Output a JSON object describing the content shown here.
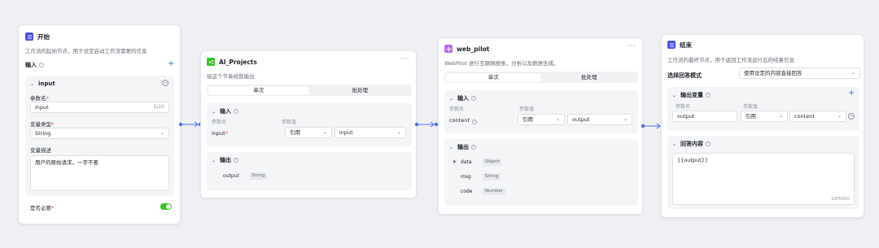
{
  "nodes": {
    "start": {
      "title": "开始",
      "desc": "工作流的起始节点，用于设定启动工作流需要的信息",
      "input_label": "输入",
      "var_name": "input",
      "param_name_label": "参数名",
      "param_name_value": "input",
      "param_name_count": "5/20",
      "var_type_label": "变量类型",
      "var_type_value": "String",
      "var_desc_label": "变量描述",
      "var_desc_value": "用户的原始请求，一字不差",
      "required_label": "是否必要",
      "required_on": true,
      "icon_color": "#4d53e8"
    },
    "ai_projects": {
      "title": "AI_Projects",
      "desc": "接这个节奏给我输出",
      "tab_single": "单次",
      "tab_batch": "批处理",
      "input_label": "输入",
      "col_param": "参数名",
      "col_value": "参数值",
      "row_name": "input",
      "row_mode": "引用",
      "row_value": "input",
      "output_label": "输出",
      "out_name": "output",
      "out_type": "String",
      "icon_color": "#34c724"
    },
    "web_pilot": {
      "title": "web_pilot",
      "desc": "WebPilot 进行互联网搜索，分析以及数据生成。",
      "tab_single": "单次",
      "tab_batch": "批处理",
      "input_label": "输入",
      "col_param": "参数名",
      "col_value": "参数值",
      "row_name": "content",
      "row_mode": "引用",
      "row_value": "output",
      "output_label": "输出",
      "outputs": [
        {
          "name": "data",
          "type": "Object"
        },
        {
          "name": "msg",
          "type": "String"
        },
        {
          "name": "code",
          "type": "Number"
        }
      ],
      "icon_color": "#b56cf0"
    },
    "end": {
      "title": "结束",
      "desc": "工作流的最终节点，用于返回工作流运行后的结果信息",
      "mode_label": "选择回答模式",
      "mode_value": "使用设定的内容直接回答",
      "output_var_label": "输出变量",
      "col_param": "参数名",
      "col_value": "参数值",
      "row_name": "output",
      "row_mode": "引用",
      "row_value": "content",
      "answer_label": "回答内容",
      "answer_value": "{{output}}",
      "answer_count": "10/5000",
      "icon_color": "#4d53e8"
    }
  },
  "colors": {
    "accent": "#3370ff",
    "connector": "#4e6ef2"
  }
}
